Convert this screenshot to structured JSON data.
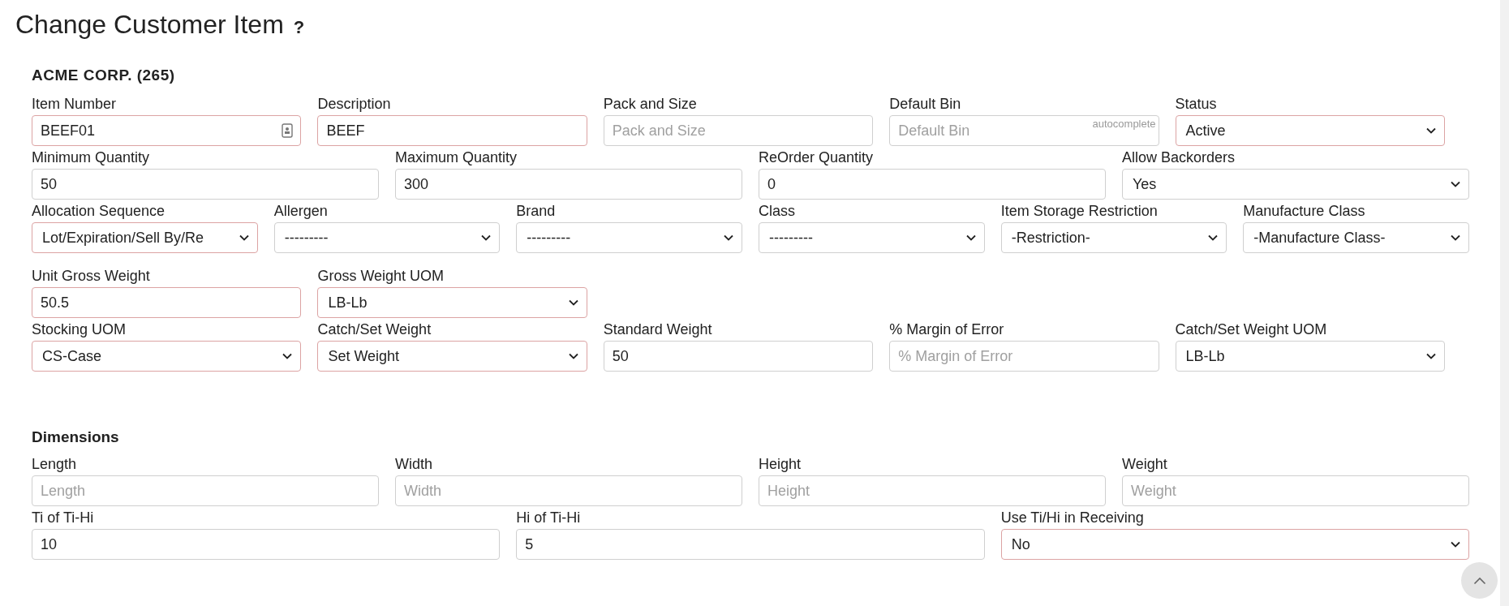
{
  "page_title": "Change Customer Item",
  "help_mark": "?",
  "customer": "ACME CORP. (265)",
  "rows": [
    {
      "fields": [
        {
          "label": "Item Number",
          "kind": "input",
          "value": "BEEF01",
          "required": true,
          "icon": true
        },
        {
          "label": "Description",
          "kind": "input",
          "value": "BEEF",
          "required": true
        },
        {
          "label": "Pack and Size",
          "kind": "input",
          "placeholder": "Pack and Size",
          "required": false
        },
        {
          "label": "Default Bin",
          "kind": "input",
          "placeholder": "Default Bin",
          "hint": "autocomplete",
          "required": false
        },
        {
          "label": "Status",
          "kind": "select",
          "value": "Active",
          "required": true
        }
      ]
    },
    {
      "fields": [
        {
          "label": "Minimum Quantity",
          "kind": "input",
          "value": "50",
          "required": false
        },
        {
          "label": "Maximum Quantity",
          "kind": "input",
          "value": "300",
          "required": false
        },
        {
          "label": "ReOrder Quantity",
          "kind": "input",
          "value": "0",
          "required": false
        },
        {
          "label": "Allow Backorders",
          "kind": "select",
          "value": "Yes",
          "required": false
        }
      ]
    },
    {
      "fields": [
        {
          "label": "Allocation Sequence",
          "kind": "select",
          "value": "Lot/Expiration/Sell By/Re",
          "required": true
        },
        {
          "label": "Allergen",
          "kind": "select",
          "value": "---------",
          "required": false
        },
        {
          "label": "Brand",
          "kind": "select",
          "value": "---------",
          "required": false
        },
        {
          "label": "Class",
          "kind": "select",
          "value": "---------",
          "required": false
        },
        {
          "label": "Item Storage Restriction",
          "kind": "select",
          "value": "-Restriction-",
          "required": false
        },
        {
          "label": "Manufacture Class",
          "kind": "select",
          "value": "-Manufacture Class-",
          "required": false
        }
      ]
    },
    {
      "fields": [
        {
          "label": "Unit Gross Weight",
          "kind": "input",
          "value": "50.5",
          "required": true
        },
        {
          "label": "Gross Weight UOM",
          "kind": "select",
          "value": "LB-Lb",
          "required": true
        }
      ]
    },
    {
      "fields": [
        {
          "label": "Stocking UOM",
          "kind": "select",
          "value": "CS-Case",
          "required": true
        },
        {
          "label": "Catch/Set Weight",
          "kind": "select",
          "value": "Set Weight",
          "required": true
        },
        {
          "label": "Standard Weight",
          "kind": "input",
          "value": "50",
          "required": false
        },
        {
          "label": "% Margin of Error",
          "kind": "input",
          "placeholder": "% Margin of Error",
          "required": false
        },
        {
          "label": "Catch/Set Weight UOM",
          "kind": "select",
          "value": "LB-Lb",
          "required": false
        }
      ]
    }
  ],
  "dimensions": {
    "heading": "Dimensions",
    "rows": [
      {
        "fields": [
          {
            "label": "Length",
            "kind": "input",
            "placeholder": "Length",
            "required": false
          },
          {
            "label": "Width",
            "kind": "input",
            "placeholder": "Width",
            "required": false
          },
          {
            "label": "Height",
            "kind": "input",
            "placeholder": "Height",
            "required": false
          },
          {
            "label": "Weight",
            "kind": "input",
            "placeholder": "Weight",
            "required": false
          }
        ]
      },
      {
        "fields": [
          {
            "label": "Ti of Ti-Hi",
            "kind": "input",
            "value": "10",
            "required": false
          },
          {
            "label": "Hi of Ti-Hi",
            "kind": "input",
            "value": "5",
            "required": false
          },
          {
            "label": "Use Ti/Hi in Receiving",
            "kind": "select",
            "value": "No",
            "required": true
          }
        ]
      }
    ]
  }
}
